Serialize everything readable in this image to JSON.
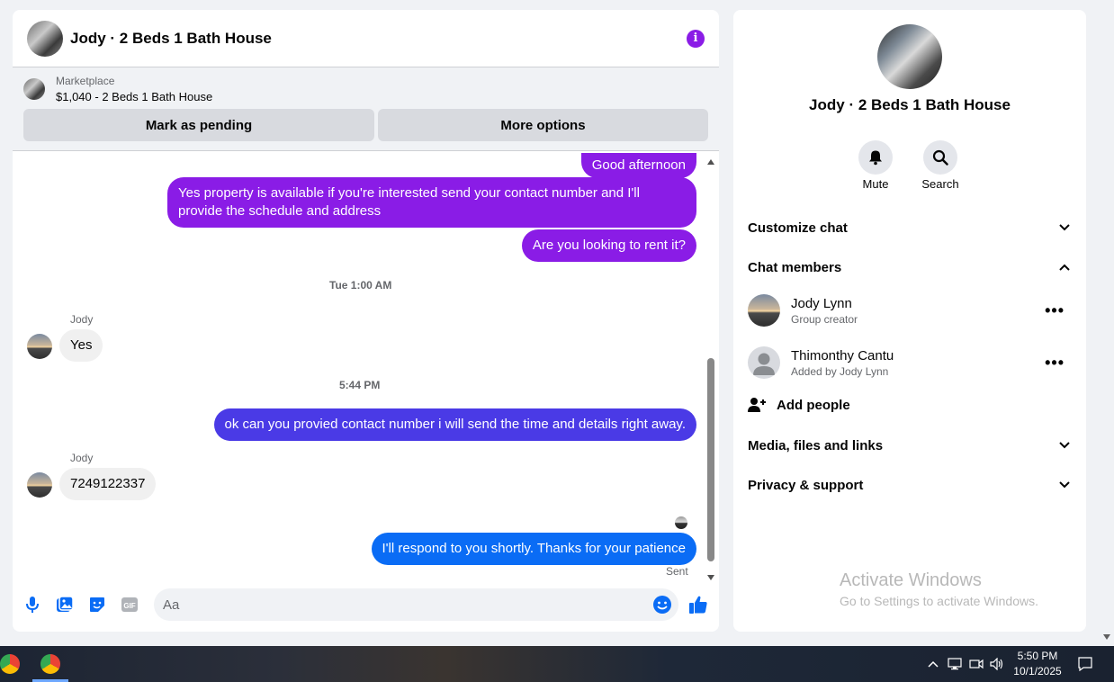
{
  "chat": {
    "title": "Jody · 2 Beds 1 Bath House",
    "marketplace_label": "Marketplace",
    "listing": "$1,040 - 2 Beds 1 Bath House",
    "pending_button": "Mark as pending",
    "more_button": "More options"
  },
  "messages": {
    "m1": "Good afternoon",
    "m2": "Yes property is  available if you're interested send your contact number and I'll provide the schedule and address",
    "m3": "Are you looking to rent it?",
    "ts1": "Tue 1:00 AM",
    "sender1": "Jody",
    "m4": "Yes",
    "ts2": "5:44 PM",
    "m5": "ok can you provied contact number i will send the time and details right away.",
    "sender2": "Jody",
    "m6": "7249122337",
    "m7": "I'll respond to you shortly. Thanks for your patience",
    "status": "Sent"
  },
  "composer": {
    "placeholder": "Aa"
  },
  "side": {
    "title": "Jody · 2 Beds 1 Bath House",
    "mute": "Mute",
    "search": "Search",
    "customize": "Customize chat",
    "members_header": "Chat members",
    "members": [
      {
        "name": "Jody Lynn",
        "sub": "Group creator"
      },
      {
        "name": "Thimonthy Cantu",
        "sub": "Added by Jody Lynn"
      }
    ],
    "add_people": "Add people",
    "media": "Media, files and links",
    "privacy": "Privacy & support"
  },
  "watermark": {
    "line1": "Activate Windows",
    "line2": "Go to Settings to activate Windows."
  },
  "taskbar": {
    "time": "5:50 PM",
    "date": "10/1/2025"
  },
  "colors": {
    "purple": "#8a1ce6",
    "indigo": "#4a3ae6",
    "blue": "#0a6cf5"
  }
}
